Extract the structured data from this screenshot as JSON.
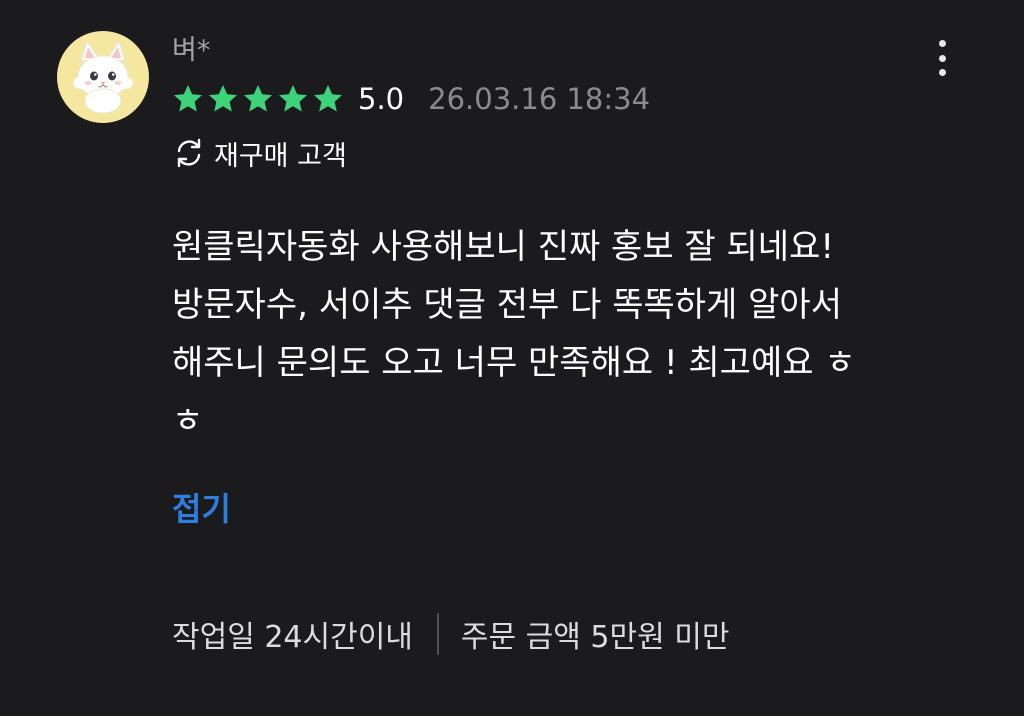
{
  "review": {
    "reviewer_name": "벼*",
    "avatar_icon": "white-cat-avatar",
    "rating": {
      "value": 5.0,
      "value_label": "5.0",
      "max": 5,
      "star_color": "#3ed37a"
    },
    "date": "26.03.16 18:34",
    "badge": {
      "icon": "refresh-icon",
      "label": "재구매 고객"
    },
    "body_lines": [
      "원클릭자동화 사용해보니 진짜 홍보 잘 되네요!",
      "방문자수, 서이추 댓글 전부 다 똑똑하게 알아서",
      "해주니 문의도 오고 너무 만족해요 ! 최고예요 ㅎ",
      "ㅎ"
    ],
    "collapse_label": "접기",
    "collapse_color": "#2f7fe0",
    "meta": {
      "work_period": "작업일 24시간이내",
      "order_amount": "주문 금액 5만원 미만"
    }
  }
}
